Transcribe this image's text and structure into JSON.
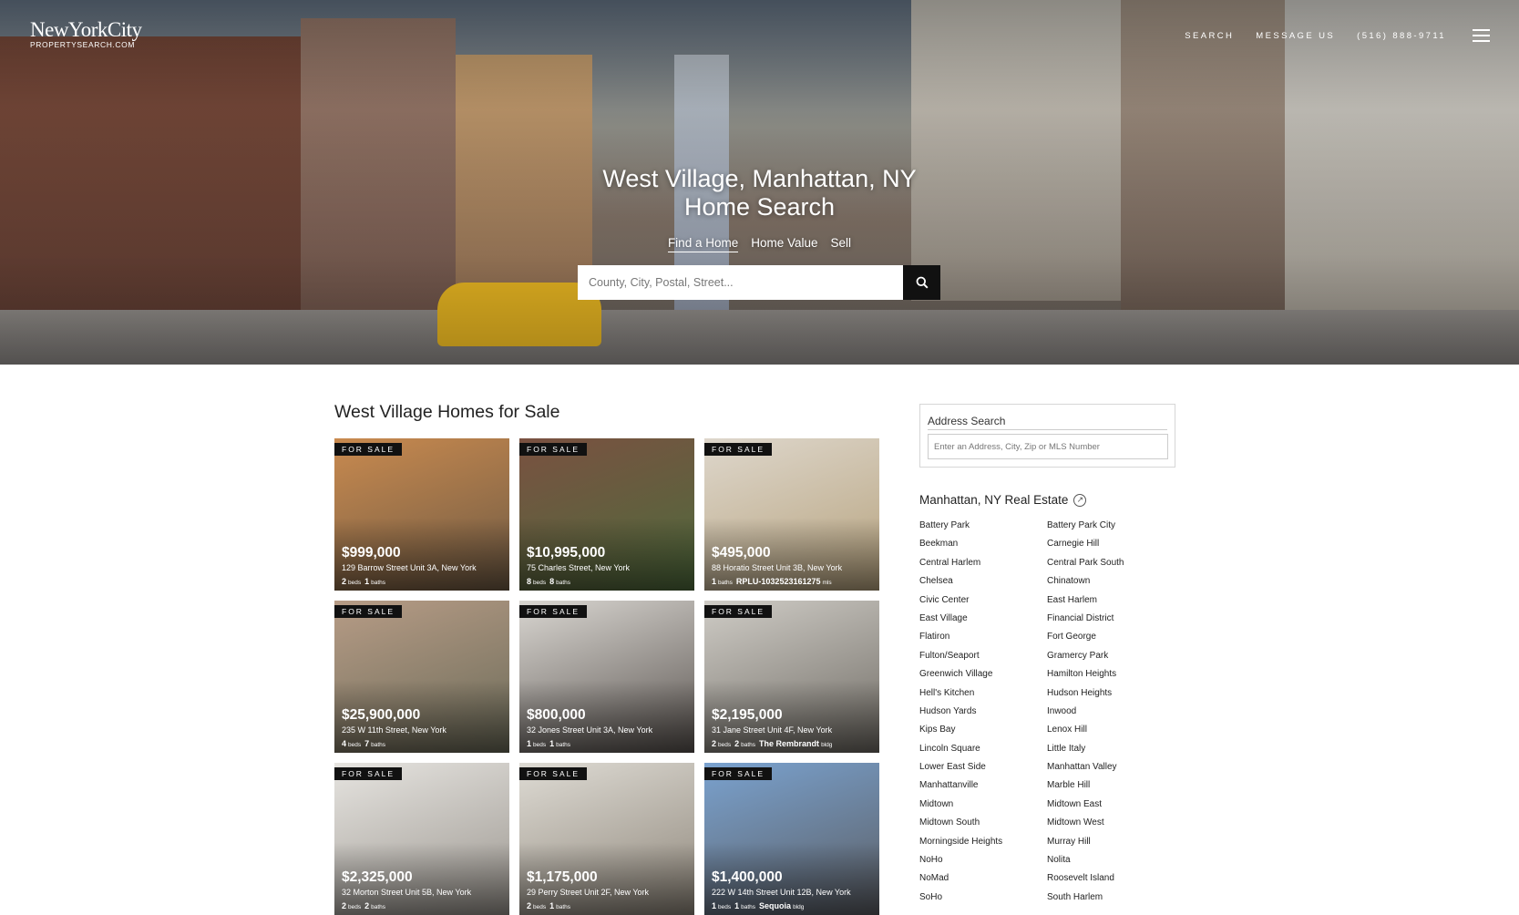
{
  "header": {
    "logo_line1": "NewYorkCity",
    "logo_line2": "PROPERTYSEARCH.COM",
    "nav": [
      "SEARCH",
      "MESSAGE US",
      "(516) 888-9711"
    ]
  },
  "hero": {
    "title_line1": "West Village, Manhattan, NY",
    "title_line2": "Home Search",
    "tabs": [
      "Find a Home",
      "Home Value",
      "Sell"
    ],
    "search_placeholder": "County, City, Postal, Street..."
  },
  "listings": {
    "section_title": "West Village Homes for Sale",
    "badge": "FOR SALE",
    "items": [
      {
        "price": "$999,000",
        "address": "129 Barrow Street Unit 3A, New York",
        "meta": [
          [
            "2",
            "beds"
          ],
          [
            "1",
            "baths"
          ]
        ],
        "colors": [
          "#c98a4f",
          "#6e5a44"
        ]
      },
      {
        "price": "$10,995,000",
        "address": "75 Charles Street, New York",
        "meta": [
          [
            "8",
            "beds"
          ],
          [
            "8",
            "baths"
          ]
        ],
        "colors": [
          "#7a5141",
          "#4e6b3c"
        ]
      },
      {
        "price": "$495,000",
        "address": "88 Horatio Street Unit 3B, New York",
        "meta": [
          [
            "1",
            "baths"
          ],
          [
            "RPLU-1032523161275",
            "mls"
          ]
        ],
        "colors": [
          "#ded7cc",
          "#b6a27d"
        ]
      },
      {
        "price": "$25,900,000",
        "address": "235 W 11th Street, New York",
        "meta": [
          [
            "4",
            "beds"
          ],
          [
            "7",
            "baths"
          ]
        ],
        "colors": [
          "#b79c86",
          "#6a6a58"
        ]
      },
      {
        "price": "$800,000",
        "address": "32 Jones Street Unit 3A, New York",
        "meta": [
          [
            "1",
            "beds"
          ],
          [
            "1",
            "baths"
          ]
        ],
        "colors": [
          "#d9d6d1",
          "#5a5450"
        ]
      },
      {
        "price": "$2,195,000",
        "address": "31 Jane Street Unit 4F, New York",
        "meta": [
          [
            "2",
            "beds"
          ],
          [
            "2",
            "baths"
          ],
          [
            "The Rembrandt",
            "bldg"
          ]
        ],
        "colors": [
          "#cfccc6",
          "#6f6b64"
        ]
      },
      {
        "price": "$2,325,000",
        "address": "32 Morton Street Unit 5B, New York",
        "meta": [
          [
            "2",
            "beds"
          ],
          [
            "2",
            "baths"
          ]
        ],
        "colors": [
          "#e6e4e0",
          "#9a958e"
        ]
      },
      {
        "price": "$1,175,000",
        "address": "29 Perry Street Unit 2F, New York",
        "meta": [
          [
            "2",
            "beds"
          ],
          [
            "1",
            "baths"
          ]
        ],
        "colors": [
          "#dedbd4",
          "#8e867a"
        ]
      },
      {
        "price": "$1,400,000",
        "address": "222 W 14th Street Unit 12B, New York",
        "meta": [
          [
            "1",
            "beds"
          ],
          [
            "1",
            "baths"
          ],
          [
            "Sequoia",
            "bldg"
          ]
        ],
        "colors": [
          "#7aa2cf",
          "#5b5d62"
        ]
      }
    ]
  },
  "sidebar": {
    "address_search_title": "Address Search",
    "address_search_placeholder": "Enter an Address, City, Zip or MLS Number",
    "real_estate_title": "Manhattan, NY Real Estate",
    "neighborhoods_col1": [
      "Battery Park",
      "Beekman",
      "Central Harlem",
      "Chelsea",
      "Civic Center",
      "East Village",
      "Flatiron",
      "Fulton/Seaport",
      "Greenwich Village",
      "Hell's Kitchen",
      "Hudson Yards",
      "Kips Bay",
      "Lincoln Square",
      "Lower East Side",
      "Manhattanville",
      "Midtown",
      "Midtown South",
      "Morningside Heights",
      "NoHo",
      "NoMad",
      "SoHo"
    ],
    "neighborhoods_col2": [
      "Battery Park City",
      "Carnegie Hill",
      "Central Park South",
      "Chinatown",
      "East Harlem",
      "Financial District",
      "Fort George",
      "Gramercy Park",
      "Hamilton Heights",
      "Hudson Heights",
      "Inwood",
      "Lenox Hill",
      "Little Italy",
      "Manhattan Valley",
      "Marble Hill",
      "Midtown East",
      "Midtown West",
      "Murray Hill",
      "Nolita",
      "Roosevelt Island",
      "South Harlem"
    ]
  },
  "colors": {
    "search_button": "#111111",
    "badge_bg": "#111111"
  }
}
